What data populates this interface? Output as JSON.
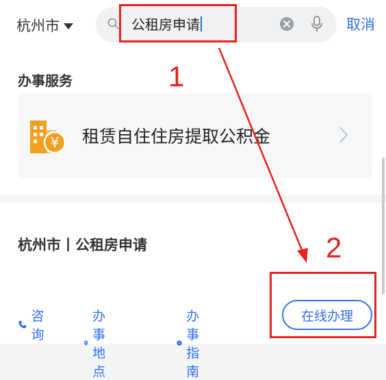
{
  "header": {
    "city": "杭州市",
    "search_query": "公租房申请",
    "cancel_label": "取消",
    "icons": [
      "chevron-down-icon",
      "search-icon",
      "clear-icon",
      "mic-icon"
    ]
  },
  "services": {
    "section_title": "办事服务",
    "items": [
      {
        "label": "租赁自住住房提取公积金",
        "icon": "house-coin-icon"
      }
    ]
  },
  "result": {
    "title": "杭州市丨公租房申请",
    "actions": [
      {
        "label": "咨询",
        "icon": "phone-icon"
      },
      {
        "label": "办事地点",
        "icon": "location-icon"
      },
      {
        "label": "办事指南",
        "icon": "compass-icon"
      }
    ],
    "online_button": "在线办理"
  },
  "annotations": {
    "label_1": "1",
    "label_2": "2",
    "color": "#e8211a"
  },
  "colors": {
    "accent": "#2f6ff0",
    "icon_orange": "#f2a024"
  }
}
